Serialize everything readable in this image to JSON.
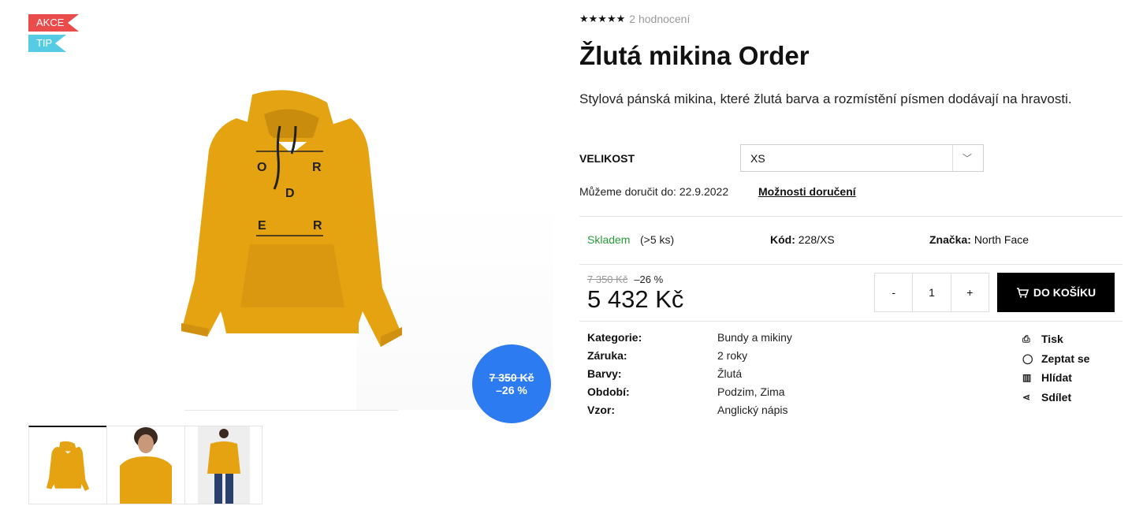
{
  "flags": {
    "akce": "AKCE",
    "tip": "TIP"
  },
  "gallery": {
    "discount_old": "7 350 Kč",
    "discount_pct": "–26 %",
    "main_letters": [
      "O",
      "R",
      "D",
      "E",
      "R"
    ]
  },
  "rating": {
    "stars": "★★★★★",
    "count_text": "2 hodnocení"
  },
  "product": {
    "title": "Žlutá mikina Order",
    "description": "Stylová pánská mikina, které žlutá barva a rozmístění písmen dodávají na hravosti."
  },
  "size": {
    "label": "VELIKOST",
    "selected": "XS"
  },
  "delivery": {
    "text": "Můžeme doručit do: 22.9.2022",
    "link": "Možnosti doručení"
  },
  "stock": {
    "status": "Skladem",
    "count": "(>5 ks)",
    "code_label": "Kód:",
    "code_value": "228/XS",
    "brand_label": "Značka:",
    "brand_value": "North Face"
  },
  "price": {
    "old": "7 350 Kč",
    "discount": "–26 %",
    "current": "5 432 Kč"
  },
  "quantity": {
    "minus": "-",
    "value": "1",
    "plus": "+"
  },
  "cart": {
    "label": "DO KOŠÍKU"
  },
  "params": [
    {
      "key": "Kategorie:",
      "value": "Bundy a mikiny"
    },
    {
      "key": "Záruka:",
      "value": "2 roky"
    },
    {
      "key": "Barvy:",
      "value": "Žlutá"
    },
    {
      "key": "Období:",
      "value": "Podzim, Zima"
    },
    {
      "key": "Vzor:",
      "value": "Anglický nápis"
    }
  ],
  "actions": [
    {
      "label": "Tisk",
      "icon": "print-icon"
    },
    {
      "label": "Zeptat se",
      "icon": "chat-icon"
    },
    {
      "label": "Hlídat",
      "icon": "watch-icon"
    },
    {
      "label": "Sdílet",
      "icon": "share-icon"
    }
  ],
  "colors": {
    "hoodie": "#e5a312",
    "accent_blue": "#2d7bf0",
    "stock_green": "#2a9a3a",
    "akce_red": "#ea4c4c",
    "tip_cyan": "#55cce3"
  }
}
